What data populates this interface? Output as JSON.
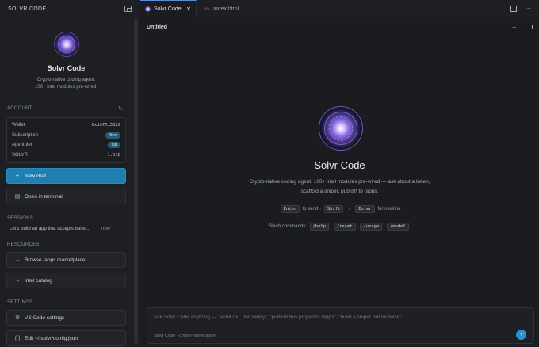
{
  "sidebar": {
    "header_title": "SOLVR CODE",
    "app_name": "Solvr Code",
    "app_desc_line1": "Crypto-native coding agent.",
    "app_desc_line2": "100+ intel modules pre-wired.",
    "account": {
      "label": "ACCOUNT",
      "rows": [
        {
          "label": "Wallet",
          "value": "0xdd77…5829"
        },
        {
          "label": "Subscription",
          "value": "free"
        },
        {
          "label": "Agent tier",
          "value": "full"
        },
        {
          "label": "SOLVR",
          "value": "1.518"
        }
      ]
    },
    "new_chat_label": "New chat",
    "open_terminal_label": "Open in terminal",
    "sessions_label": "SESSIONS",
    "session": {
      "title": "Let's build an app that accepts base ...",
      "time": "now"
    },
    "resources_label": "RESOURCES",
    "resources": [
      {
        "icon": "→",
        "label": "Browse /apps marketplace"
      },
      {
        "icon": "→",
        "label": "Intel catalog"
      }
    ],
    "settings_label": "SETTINGS",
    "settings": [
      {
        "icon": "⚙",
        "label": "VS Code settings"
      },
      {
        "icon": "{ }",
        "label": "Edit ~/.solvr/config.json"
      }
    ]
  },
  "tabs": [
    {
      "label": "Solvr Code",
      "close": "✕"
    },
    {
      "label": "index.html",
      "icon": "<>"
    }
  ],
  "main": {
    "doc_title": "Untitled",
    "add_icon": "+",
    "hero_title": "Solvr Code",
    "hero_desc": "Crypto-native coding agent. 100+ intel modules pre-wired — ask about a token, scaffold a sniper, publish to /apps.",
    "keys": {
      "enter": "Enter",
      "to_send": "to send ·",
      "shift": "Shift",
      "plus": "+",
      "enter2": "Enter",
      "for_newline": "for newline"
    },
    "slash": {
      "label": "Slash commands:",
      "commands": [
        "/help",
        "/reset",
        "/usage",
        "/model"
      ]
    },
    "composer": {
      "placeholder": "Ask Solvr Code anything — \"audit 0x... for safety\", \"publish this project to /apps\", \"build a sniper bot for base\"…",
      "footer": "Solvr Code · crypto-native agent",
      "send_icon": "↑"
    }
  },
  "colors": {
    "accent": "#1e7fb3",
    "pill": "#2b5d72",
    "send": "#2b8fd0"
  }
}
